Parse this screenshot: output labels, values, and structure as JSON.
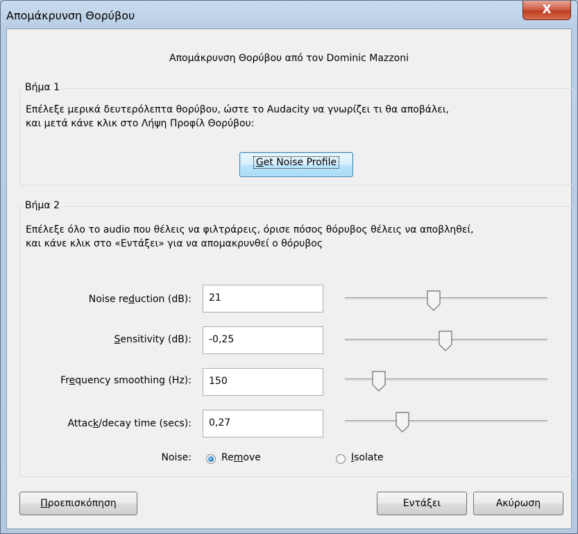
{
  "window": {
    "title": "Απομάκρυνση Θορύβου",
    "close_label": "X"
  },
  "heading": "Απομάκρυνση Θορύβου από τον Dominic Mazzoni",
  "step1": {
    "legend": "Βήμα 1",
    "line1": "Επέλεξε μερικά δευτερόλεπτα θορύβου, ώστε το Audacity να γνωρίζει τι θα αποβάλει,",
    "line2": "και μετά κάνε κλικ στο Λήψη Προφίλ Θορύβου:",
    "button": {
      "mnemonic": "G",
      "rest": "et Noise Profile"
    }
  },
  "step2": {
    "legend": "Βήμα 2",
    "line1": "Επέλεξε όλο το audio που θέλεις να φιλτράρεις, όρισε πόσος θόρυβος θέλεις να αποβληθεί,",
    "line2": "και κάνε κλικ στο «Εντάξει» για να απομακρυνθεί ο θόρυβος",
    "params": [
      {
        "pre": "Noise re",
        "mn": "d",
        "post": "uction (dB):",
        "value": "21",
        "slider": 0.44
      },
      {
        "pre": "",
        "mn": "S",
        "post": "ensitivity (dB):",
        "value": "-0,25",
        "slider": 0.5
      },
      {
        "pre": "Fr",
        "mn": "e",
        "post": "quency smoothing (Hz):",
        "value": "150",
        "slider": 0.17
      },
      {
        "pre": "Attac",
        "mn": "k",
        "post": "/decay time (secs):",
        "value": "0,27",
        "slider": 0.28
      }
    ],
    "noise": {
      "label": "Noise:",
      "remove": {
        "pre": "Re",
        "mn": "m",
        "post": "ove",
        "selected": true
      },
      "isolate": {
        "pre": "",
        "mn": "I",
        "post": "solate",
        "selected": false
      }
    }
  },
  "buttons": {
    "preview": {
      "mn": "Π",
      "rest": "ροεπισκόπηση"
    },
    "ok": "Εντάξει",
    "cancel": "Ακύρωση"
  }
}
